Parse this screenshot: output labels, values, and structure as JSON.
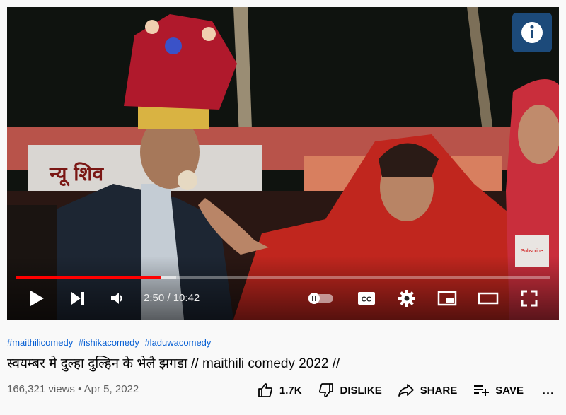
{
  "player": {
    "time_current": "2:50",
    "time_separator": " / ",
    "time_total": "10:42",
    "progress_played": 0.271,
    "progress_buffered": 0.3,
    "watermark_label": "Subscribe",
    "cc_label": "CC",
    "icons": [
      "play-icon",
      "next-icon",
      "volume-icon",
      "autoplay-toggle-icon",
      "captions-icon",
      "settings-icon",
      "miniplayer-icon",
      "theater-icon",
      "fullscreen-icon"
    ]
  },
  "video": {
    "hashtags": [
      "#maithilicomedy",
      "#ishikacomedy",
      "#laduwacomedy"
    ],
    "title": "स्वयम्बर मे दुल्हा दुल्हिन के भेलै झगडा // maithili comedy 2022 //",
    "views": "166,321 views",
    "separator": " • ",
    "date": "Apr 5, 2022"
  },
  "actions": {
    "like": "1.7K",
    "dislike": "DISLIKE",
    "share": "SHARE",
    "save": "SAVE",
    "more": "..."
  },
  "colors": {
    "progress": "#ff0000",
    "link": "#065fd4"
  }
}
